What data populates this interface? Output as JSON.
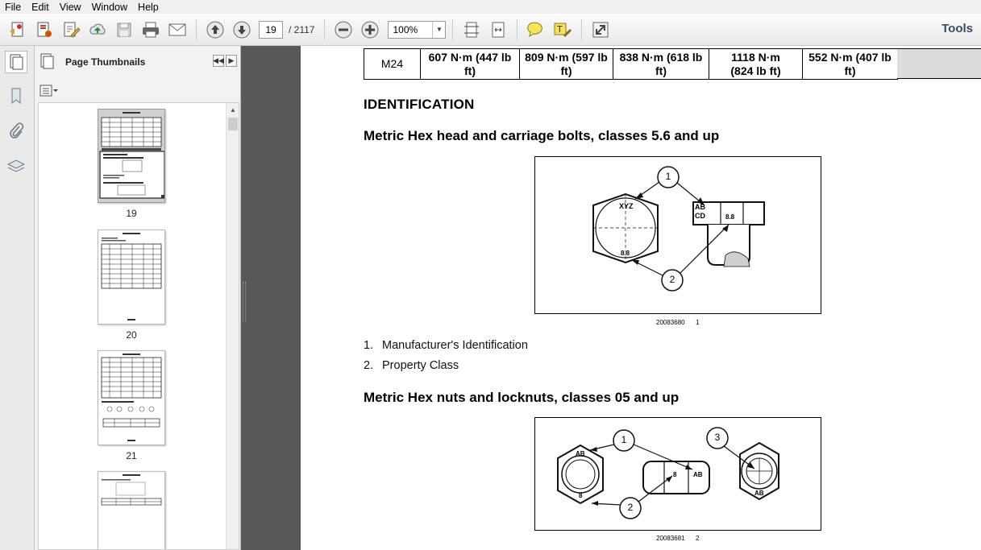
{
  "menu": {
    "items": [
      "File",
      "Edit",
      "View",
      "Window",
      "Help"
    ]
  },
  "toolbar": {
    "current_page": "19",
    "total_pages": "/ 2117",
    "zoom": "100%",
    "tools_label": "Tools"
  },
  "thumbnails_panel": {
    "title": "Page Thumbnails",
    "pages": [
      {
        "label": "19",
        "selected": true
      },
      {
        "label": "20"
      },
      {
        "label": "21"
      },
      {
        "label": ""
      }
    ]
  },
  "document": {
    "table_row": {
      "size": "M24",
      "cells": [
        [
          "607 N·m (447 lb",
          "ft)"
        ],
        [
          "809 N·m (597 lb",
          "ft)"
        ],
        [
          "838 N·m (618 lb",
          "ft)"
        ],
        [
          "1118 N·m",
          "(824 lb ft)"
        ],
        [
          "552 N·m (407 lb",
          "ft)"
        ]
      ]
    },
    "identification_heading": "IDENTIFICATION",
    "section1_heading": "Metric Hex head and carriage bolts, classes 5.6 and up",
    "figure1": {
      "caption_id": "20083680",
      "caption_num": "1",
      "callouts": [
        "1",
        "2"
      ],
      "labels": {
        "head_mark": "XYZ",
        "class_mark": "8.8",
        "carriage_mark_1": "AB",
        "carriage_mark_2": "CD",
        "carriage_class": "8.8"
      }
    },
    "legend": [
      {
        "num": "1.",
        "text": "Manufacturer's Identification"
      },
      {
        "num": "2.",
        "text": "Property Class"
      }
    ],
    "section2_heading": "Metric Hex nuts and locknuts, classes 05 and up",
    "figure2": {
      "caption_id": "20083681",
      "caption_num": "2",
      "callouts": [
        "1",
        "2",
        "3"
      ],
      "labels": {
        "nut_top": "AB",
        "nut_bottom": "8",
        "side_class": "8",
        "side_mark": "AB",
        "lock_bottom": "AB"
      }
    }
  }
}
